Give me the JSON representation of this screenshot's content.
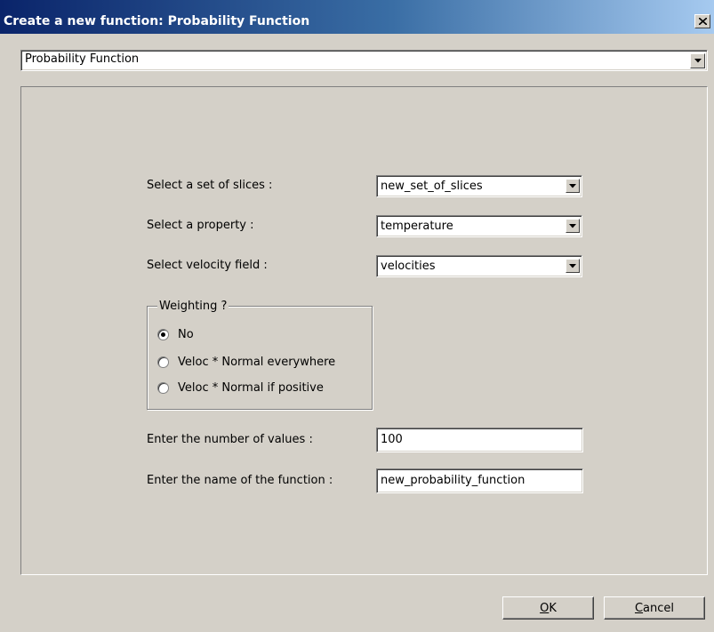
{
  "window": {
    "title": "Create a new function: Probability Function",
    "close_icon": "close-icon"
  },
  "function_type": {
    "selected": "Probability Function"
  },
  "form": {
    "slices": {
      "label": "Select a set of slices :",
      "value": "new_set_of_slices"
    },
    "property": {
      "label": "Select a property :",
      "value": "temperature"
    },
    "velocity": {
      "label": "Select velocity field :",
      "value": "velocities"
    },
    "weighting": {
      "legend": "Weighting ?",
      "options": [
        {
          "label": "No",
          "checked": true
        },
        {
          "label": "Veloc * Normal everywhere",
          "checked": false
        },
        {
          "label": "Veloc * Normal if positive",
          "checked": false
        }
      ]
    },
    "num_values": {
      "label": "Enter the number of values :",
      "value": "100"
    },
    "func_name": {
      "label": "Enter the name of the function :",
      "value": "new_probability_function"
    }
  },
  "buttons": {
    "ok_mnemonic": "O",
    "ok_rest": "K",
    "cancel_mnemonic": "C",
    "cancel_rest": "ancel"
  },
  "colors": {
    "titlebar_start": "#0a246a",
    "titlebar_end": "#a6caf0",
    "face": "#d4d0c8"
  }
}
